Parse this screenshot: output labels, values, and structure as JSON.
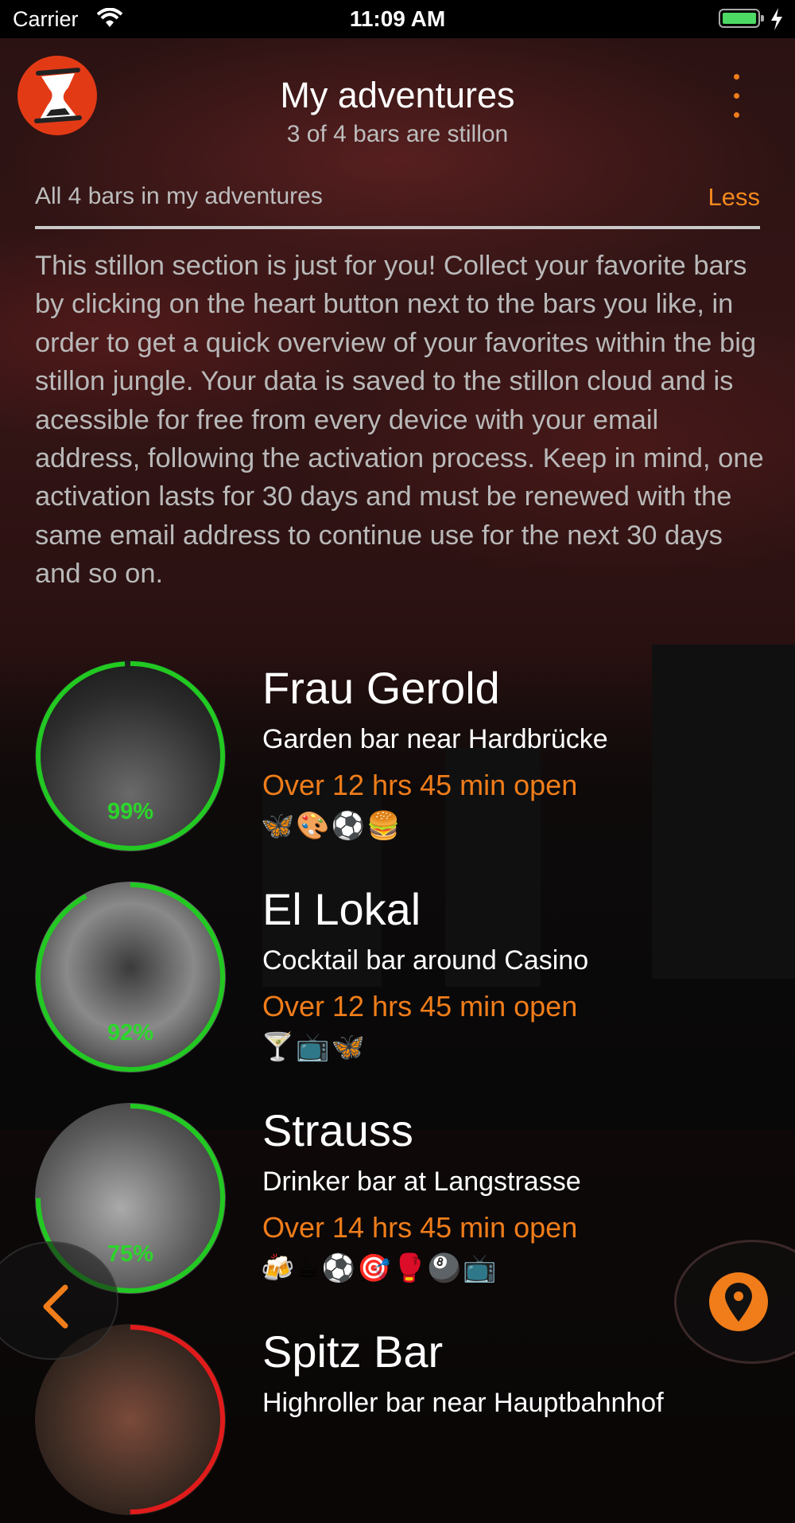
{
  "status_bar": {
    "carrier": "Carrier",
    "time": "11:09 AM"
  },
  "header": {
    "title": "My adventures",
    "subtitle": "3 of 4 bars are stillon"
  },
  "section": {
    "label": "All 4 bars in my adventures",
    "toggle": "Less"
  },
  "description": "This stillon section is just for you! Collect your favorite bars by clicking on the heart button next to the bars you like, in order to get a quick overview of your favorites within the big stillon jungle. Your data is saved to the stillon cloud and is acessible for free from every device with your email address, following the activation process. Keep in mind, one activation lasts for 30 days and must be renewed with the same email address to continue use for the next 30 days and so on.",
  "bars": [
    {
      "name": "Frau Gerold",
      "desc": "Garden bar near Hardbrücke",
      "open": "Over 12 hrs 45 min open",
      "icons": "🦋🎨⚽🍔",
      "percent": "99%",
      "progress": 0.99,
      "ring": "#22c922"
    },
    {
      "name": "El Lokal",
      "desc": "Cocktail bar around Casino",
      "open": "Over 12 hrs 45 min open",
      "icons": "🍸📺🦋",
      "percent": "92%",
      "progress": 0.92,
      "ring": "#22c922"
    },
    {
      "name": "Strauss",
      "desc": "Drinker bar at Langstrasse",
      "open": "Over 14 hrs 45 min open",
      "icons": "🍻☕⚽🎯🥊🎱📺",
      "percent": "75%",
      "progress": 0.75,
      "ring": "#22c922"
    },
    {
      "name": "Spitz Bar",
      "desc": "Highroller bar near Hauptbahnhof",
      "open": "",
      "icons": "",
      "percent": "",
      "progress": 0.5,
      "ring": "#e11b1b"
    }
  ],
  "colors": {
    "accent": "#f07d1a",
    "open_ring": "#22c922",
    "closed_ring": "#e11b1b",
    "logo": "#e33a16"
  },
  "icons": {
    "logo": "hourglass-icon",
    "menu": "more-vertical-icon",
    "back": "chevron-left-icon",
    "map": "location-pin-icon"
  }
}
